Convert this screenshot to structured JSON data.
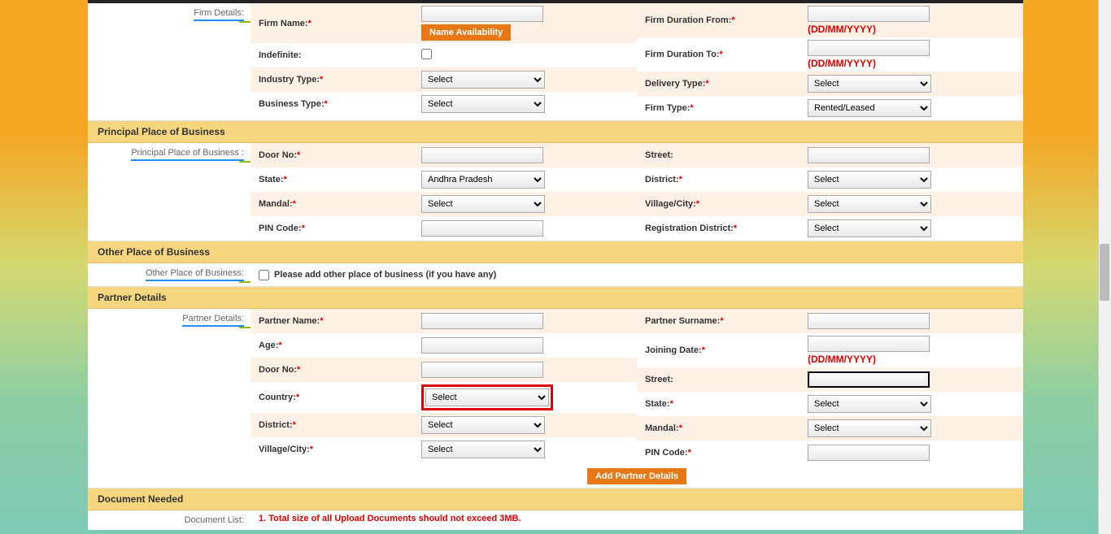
{
  "firm": {
    "side_label": "Firm Details:",
    "name_label": "Firm Name:",
    "name_avail_btn": "Name Availability",
    "duration_from_label": "Firm Duration From:",
    "duration_from_hint": "(DD/MM/YYYY)",
    "indefinite_label": "Indefinite:",
    "duration_to_label": "Firm Duration To:",
    "duration_to_hint": "(DD/MM/YYYY)",
    "industry_label": "Industry Type:",
    "industry_val": "Select",
    "delivery_label": "Delivery Type:",
    "delivery_val": "Select",
    "business_label": "Business Type:",
    "business_val": "Select",
    "firmtype_label": "Firm Type:",
    "firmtype_val": "Rented/Leased"
  },
  "principal": {
    "header": "Principal Place of Business",
    "side_label": "Principal Place of Business :",
    "door_label": "Door No:",
    "street_label": "Street:",
    "state_label": "State:",
    "state_val": "Andhra Pradesh",
    "district_label": "District:",
    "district_val": "Select",
    "mandal_label": "Mandal:",
    "mandal_val": "Select",
    "village_label": "Village/City:",
    "village_val": "Select",
    "pin_label": "PIN Code:",
    "regdist_label": "Registration District:",
    "regdist_val": "Select"
  },
  "other": {
    "header": "Other Place of Business",
    "side_label": "Other Place of Business:",
    "check_label": "Please add other place of business (if you have any)"
  },
  "partner": {
    "header": "Partner Details",
    "side_label": "Partner Details:",
    "name_label": "Partner Name:",
    "surname_label": "Partner Surname:",
    "age_label": "Age:",
    "join_label": "Joining Date:",
    "join_hint": "(DD/MM/YYYY)",
    "door_label": "Door No:",
    "street_label": "Street:",
    "country_label": "Country:",
    "country_val": "Select",
    "state_label": "State:",
    "state_val": "Select",
    "district_label": "District:",
    "district_val": "Select",
    "mandal_label": "Mandal:",
    "mandal_val": "Select",
    "village_label": "Village/City:",
    "village_val": "Select",
    "pin_label": "PIN Code:",
    "add_btn": "Add Partner Details"
  },
  "document": {
    "header": "Document Needed",
    "side_label": "Document List:",
    "note": "1. Total size of all Upload Documents should not exceed 3MB."
  }
}
